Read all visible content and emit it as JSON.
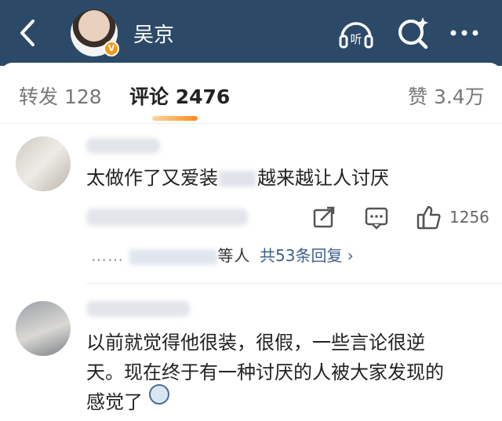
{
  "header": {
    "user_name": "吴京",
    "vip_badge": "V",
    "back_icon": "chevron-left-icon",
    "listen_label": "听",
    "search_icon": "search-sparkle-icon",
    "more_icon": "more-icon",
    "bg_color": "#2c4a68"
  },
  "tabs": {
    "repost": "转发 128",
    "comment": "评论 2476",
    "like": "赞 3.4万"
  },
  "comments": [
    {
      "text": "太做作了又爱装",
      "text2": "越来越让人讨厌",
      "like_count": "1256",
      "reply_prefix": "……",
      "reply_mid": "等人",
      "reply_link": "共53条回复 ›"
    },
    {
      "line1": "以前就觉得他很装，很假，一些言论很逆",
      "line2": "天。现在终于有一种讨厌的人被大家发现的",
      "line3": "感觉了"
    }
  ],
  "accent": "#ff8a1a",
  "link_color": "#3e5f8a"
}
